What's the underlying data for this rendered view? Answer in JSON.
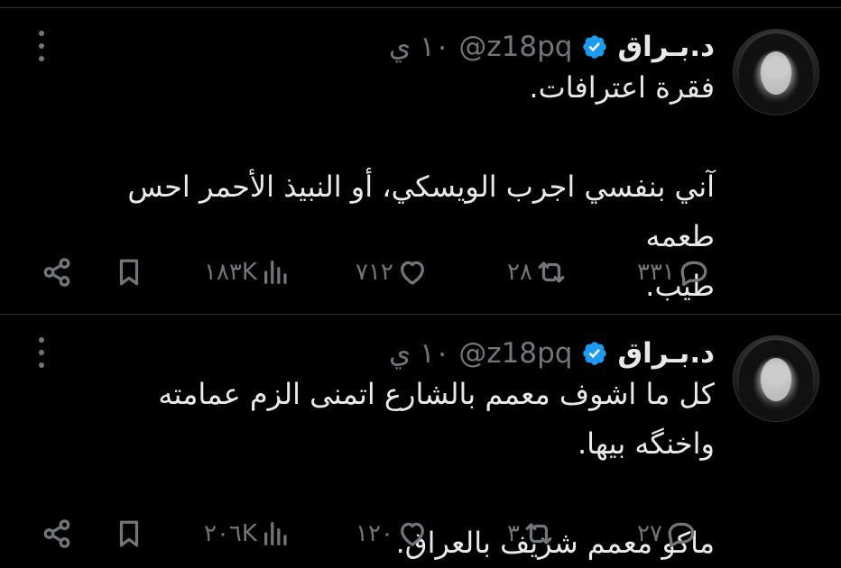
{
  "tweets": [
    {
      "author_name": "د.بـراق",
      "handle": "@z18pq",
      "time": "١٠ ي",
      "text_lines": [
        "فقرة اعترافات.",
        "",
        "آني بنفسي اجرب الويسكي، أو النبيذ الأحمر احس طعمه",
        "طيب."
      ],
      "replies": "٣٣١",
      "retweets": "٢٨",
      "likes": "٧١٢",
      "views": "١٨٣K"
    },
    {
      "author_name": "د.بـراق",
      "handle": "@z18pq",
      "time": "١٠ ي",
      "text_lines": [
        "كل ما اشوف معمم بالشارع اتمنى الزم عمامته واخنگه بيها.",
        "",
        "ماكو معمم شريف بالعراق."
      ],
      "replies": "٢٧",
      "retweets": "٣",
      "likes": "١٢٠",
      "views": "٢٠٦K"
    }
  ],
  "colors": {
    "background": "#000000",
    "text": "#e7e9ea",
    "muted": "#71767b",
    "verified": "#1d9bf0",
    "divider": "#2f3336"
  },
  "icons": [
    "more-icon",
    "verified-icon",
    "share-icon",
    "bookmark-icon",
    "views-icon",
    "like-icon",
    "retweet-icon",
    "reply-icon"
  ]
}
